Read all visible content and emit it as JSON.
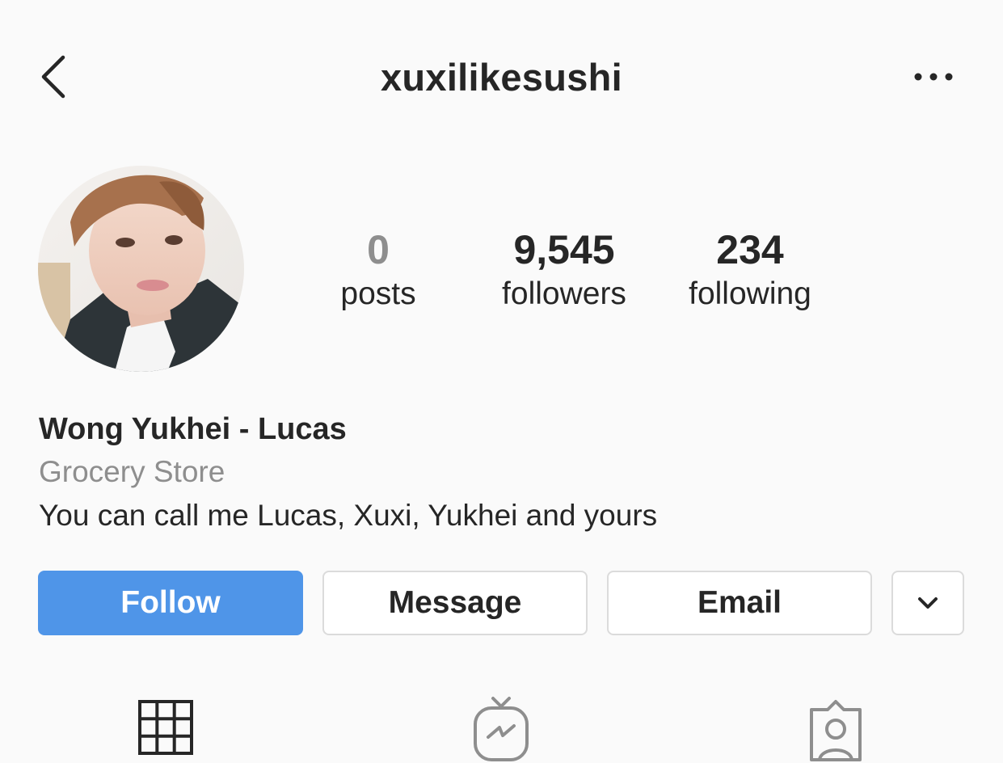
{
  "header": {
    "username": "xuxilikesushi",
    "back_icon": "chevron-left-icon",
    "more_icon": "more-horizontal-icon"
  },
  "profile": {
    "avatar_icon": "profile-photo"
  },
  "stats": [
    {
      "value": "0",
      "label": "posts"
    },
    {
      "value": "9,545",
      "label": "followers"
    },
    {
      "value": "234",
      "label": "following"
    }
  ],
  "bio": {
    "name": "Wong Yukhei - Lucas",
    "category": "Grocery Store",
    "text": "You can call me Lucas, Xuxi, Yukhei and yours"
  },
  "actions": {
    "follow_label": "Follow",
    "message_label": "Message",
    "email_label": "Email",
    "dropdown_icon": "chevron-down-icon"
  },
  "tabs": [
    {
      "icon": "grid-icon"
    },
    {
      "icon": "igtv-icon"
    },
    {
      "icon": "tagged-icon"
    }
  ],
  "colors": {
    "follow_button": "#4f95e8",
    "background": "#fafafa",
    "text_primary": "#262626",
    "text_secondary": "#8e8e8e"
  }
}
